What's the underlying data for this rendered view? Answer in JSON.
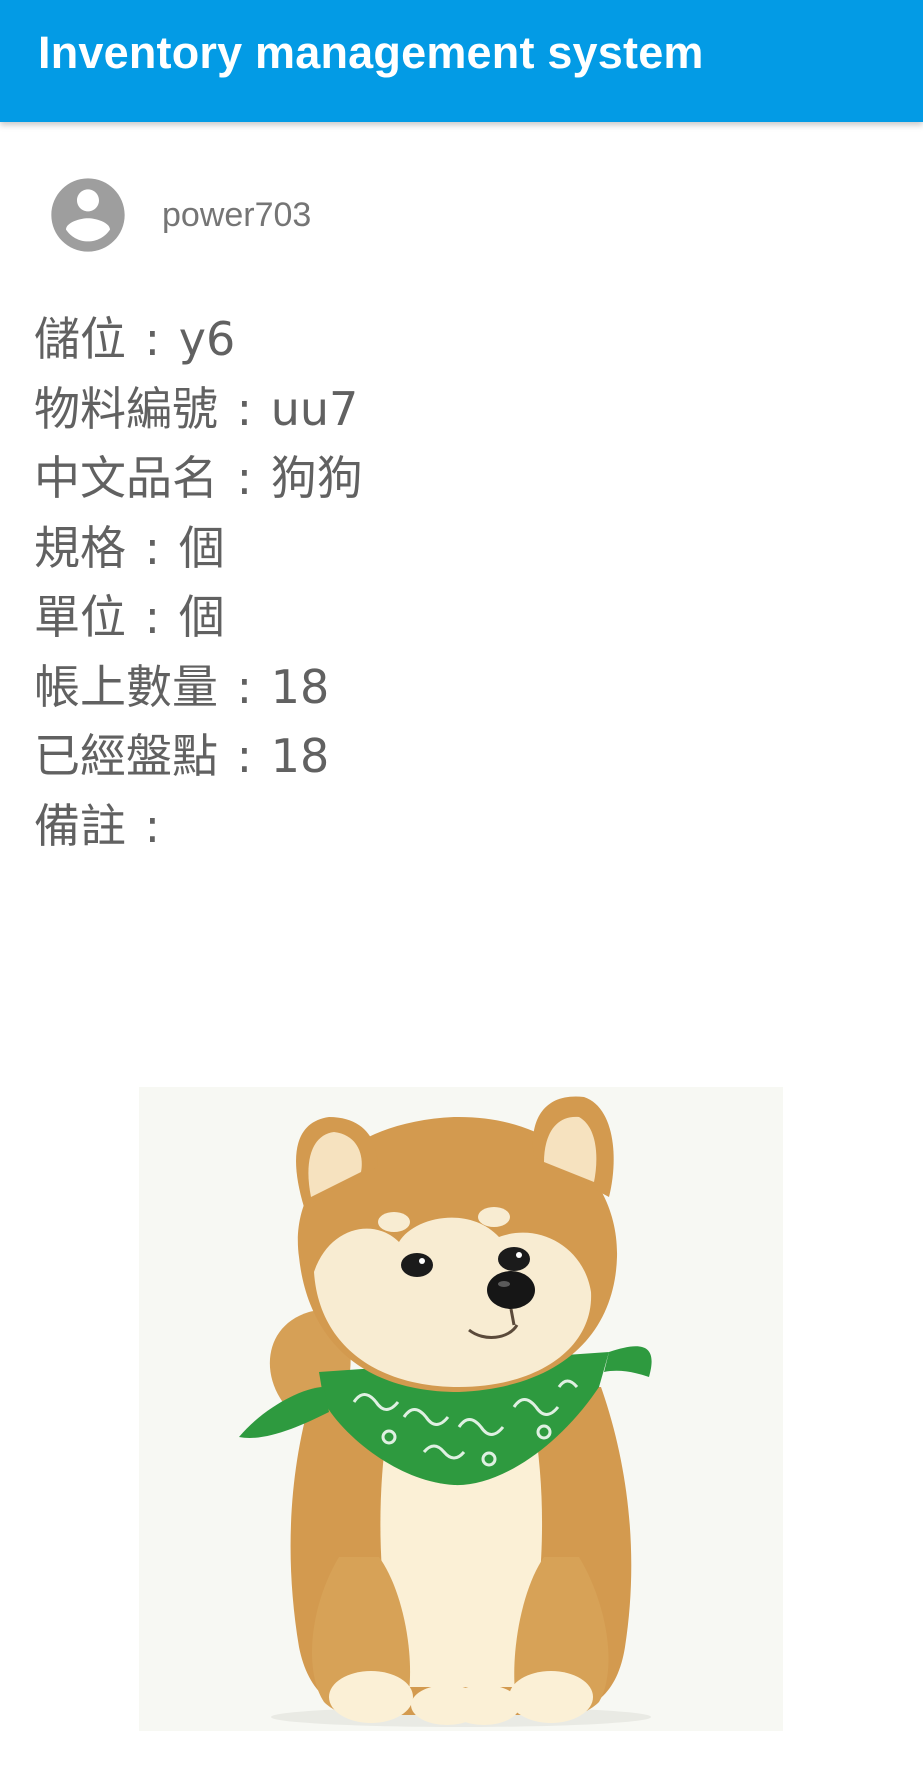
{
  "app_bar": {
    "title": "Inventory management system"
  },
  "user": {
    "avatar_icon": "account-circle-icon",
    "username": "power703"
  },
  "details": [
    {
      "key": "location",
      "label": "儲位",
      "value": "y6"
    },
    {
      "key": "item_no",
      "label": "物料編號",
      "value": "uu7"
    },
    {
      "key": "name_zh",
      "label": "中文品名",
      "value": "狗狗"
    },
    {
      "key": "spec",
      "label": "規格",
      "value": "個"
    },
    {
      "key": "unit",
      "label": "單位",
      "value": "個"
    },
    {
      "key": "book_qty",
      "label": "帳上數量",
      "value": "18"
    },
    {
      "key": "counted_qty",
      "label": "已經盤點",
      "value": "18"
    },
    {
      "key": "remark",
      "label": "備註",
      "value": ""
    }
  ],
  "separator": ":",
  "colors": {
    "app_bar": "#039be5",
    "app_bar_text": "#ffffff",
    "detail_text": "#616161",
    "avatar": "#9e9e9e"
  }
}
